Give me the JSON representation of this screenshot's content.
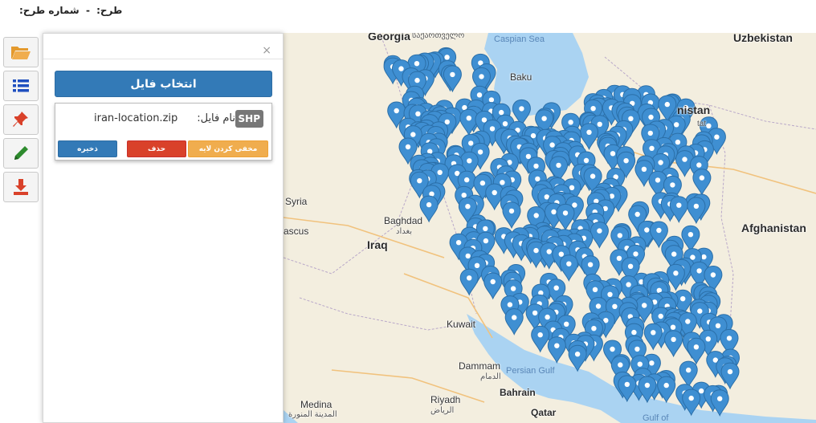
{
  "header": {
    "plan_label": "طرح:",
    "separator": "-",
    "plan_number_label": "شماره طرح:"
  },
  "toolbar": {
    "buttons": [
      {
        "name": "open-folder",
        "icon": "folder-open-icon",
        "color": "#f0ad4e"
      },
      {
        "name": "layer-list",
        "icon": "list-icon",
        "color": "#1f4fbf"
      },
      {
        "name": "pin",
        "icon": "pushpin-icon",
        "color": "#d9412a"
      },
      {
        "name": "edit",
        "icon": "pencil-icon",
        "color": "#2e8b2e"
      },
      {
        "name": "download",
        "icon": "download-icon",
        "color": "#d9412a"
      }
    ]
  },
  "panel": {
    "close": "×",
    "choose_file": "انتخاب فایل",
    "file": {
      "badge": "SHP",
      "label": "نام فایل:",
      "name": "iran-location.zip",
      "save": "ذخیره",
      "delete": "حذف",
      "hide_layer": "مخفی کردن لایه"
    }
  },
  "map": {
    "labels": {
      "georgia": "Georgia",
      "georgia_native": "საქართველო",
      "caspian": "Caspian Sea",
      "uzbekistan": "Uzbekistan",
      "baku": "Baku",
      "turkmenistan_part": "nistan",
      "turkmenistan_part2": "tat",
      "syria": "Syria",
      "baghdad": "Baghdad",
      "baghdad_native": "بغداد",
      "damascus_part": "ascus",
      "iraq": "Iraq",
      "afghanistan": "Afghanistan",
      "kuwait": "Kuwait",
      "dammam": "Dammam",
      "dammam_native": "الدمام",
      "persian_gulf": "Persian Gulf",
      "bahrain": "Bahrain",
      "riyadh": "Riyadh",
      "riyadh_native": "الرياض",
      "medina": "Medina",
      "medina_native": "المدينة المنورة",
      "qatar": "Qatar",
      "gulf_of_oman_part": "Gulf of"
    },
    "colors": {
      "land": "#f3eedf",
      "water": "#aad3f2",
      "marker": "#3f8fd2",
      "marker_stroke": "#2b6fa8"
    }
  }
}
